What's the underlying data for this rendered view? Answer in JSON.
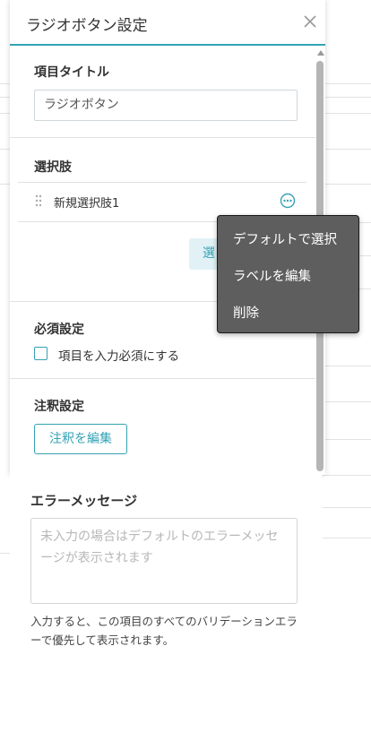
{
  "panel": {
    "title": "ラジオボタン設定"
  },
  "item_title": {
    "heading": "項目タイトル",
    "value": "ラジオボタン"
  },
  "choices": {
    "heading": "選択肢",
    "options": [
      {
        "label": "新規選択肢1"
      }
    ],
    "add_button_label": "選"
  },
  "context_menu": {
    "items": [
      {
        "label": "デフォルトで選択"
      },
      {
        "label": "ラベルを編集"
      },
      {
        "label": "削除"
      }
    ]
  },
  "required": {
    "heading": "必須設定",
    "checkbox_label": "項目を入力必須にする",
    "checked": false
  },
  "annotation": {
    "heading": "注釈設定",
    "button_label": "注釈を編集"
  },
  "error_message": {
    "heading": "エラーメッセージ",
    "placeholder": "未入力の場合はデフォルトのエラーメッセージが表示されます",
    "help_text": "入力すると、この項目のすべてのバリデーションエラーで優先して表示されます。"
  },
  "icons": {
    "close": "close-icon",
    "drag": "drag-handle-icon",
    "more": "more-options-icon",
    "scroll_up": "scroll-up-arrow-icon"
  },
  "colors": {
    "accent": "#35a2b4",
    "menu_background": "#5e5e5e",
    "add_button_background": "#e1f1f5"
  }
}
